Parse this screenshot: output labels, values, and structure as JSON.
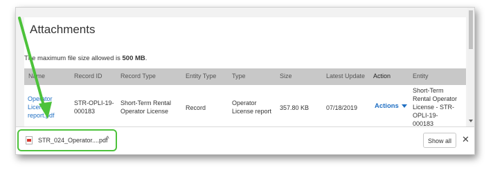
{
  "panel": {
    "title": "Attachments",
    "size_note_prefix": "The maximum file size allowed is ",
    "size_note_value": "500 MB",
    "size_note_suffix": "."
  },
  "table": {
    "headers": [
      "Name",
      "Record ID",
      "Record Type",
      "Entity Type",
      "Type",
      "Size",
      "Latest Update",
      "Action",
      "Entity"
    ],
    "row": {
      "name_lines": [
        "Operator",
        "License",
        "report.pdf"
      ],
      "record_id_lines": [
        "STR-OPLI-19-",
        "000183"
      ],
      "record_type_lines": [
        "Short-Term Rental",
        "Operator License"
      ],
      "entity_type": "Record",
      "type_lines": [
        "Operator",
        "License report"
      ],
      "size": "357.80 KB",
      "latest_update": "07/18/2019",
      "action": "Actions",
      "entity_lines": [
        "Short-Term",
        "Rental Operator",
        "License - STR-",
        "OPLI-19-",
        "000183"
      ]
    }
  },
  "download_bar": {
    "file_name": "STR_024_Operator....pdf",
    "chevron": "^",
    "show_all": "Show all",
    "close": "✕"
  },
  "colors": {
    "link": "#1f6fc3",
    "arrow": "#4cc23a",
    "header_bg": "#c8c8c8"
  }
}
